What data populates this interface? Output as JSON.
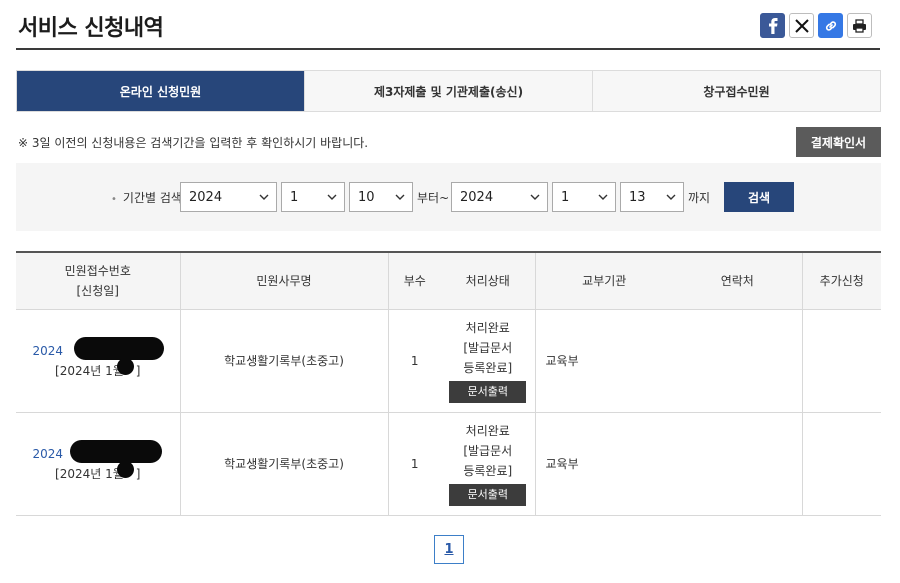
{
  "page": {
    "title": "서비스 신청내역"
  },
  "share": {
    "icons": [
      "facebook-icon",
      "x-icon",
      "link-icon",
      "print-icon"
    ]
  },
  "tabs": [
    {
      "label": "온라인 신청민원",
      "active": true
    },
    {
      "label": "제3자제출 및 기관제출(송신)",
      "active": false
    },
    {
      "label": "창구접수민원",
      "active": false
    }
  ],
  "notice": "※ 3일 이전의 신청내용은 검색기간을 입력한 후 확인하시기 바랍니다.",
  "confirm_button": "결제확인서",
  "search": {
    "label": "기간별 검색",
    "from_year": "2024",
    "from_month": "1",
    "from_day": "10",
    "from_suffix": "부터~",
    "to_year": "2024",
    "to_month": "1",
    "to_day": "13",
    "to_suffix": "까지",
    "button": "검색"
  },
  "table": {
    "headers": {
      "receipt_line1": "민원접수번호",
      "receipt_line2": "[신청일]",
      "item": "민원사무명",
      "count": "부수",
      "status": "처리상태",
      "agency": "교부기관",
      "contact": "연락처",
      "extra": "추가신청"
    },
    "rows": [
      {
        "receipt_no": "2024",
        "date": "[2024년 1월",
        "date_end": "]",
        "item": "학교생활기록부(초중고)",
        "count": "1",
        "status1": "처리완료",
        "status2": "[발급문서",
        "status3": "등록완료]",
        "doc_button": "문서출력",
        "agency": "교육부",
        "contact": "",
        "extra": ""
      },
      {
        "receipt_no": "2024",
        "date": "[2024년 1월",
        "date_end": "]",
        "item": "학교생활기록부(초중고)",
        "count": "1",
        "status1": "처리완료",
        "status2": "[발급문서",
        "status3": "등록완료]",
        "doc_button": "문서출력",
        "agency": "교육부",
        "contact": "",
        "extra": ""
      }
    ]
  },
  "pagination": {
    "current": "1"
  }
}
